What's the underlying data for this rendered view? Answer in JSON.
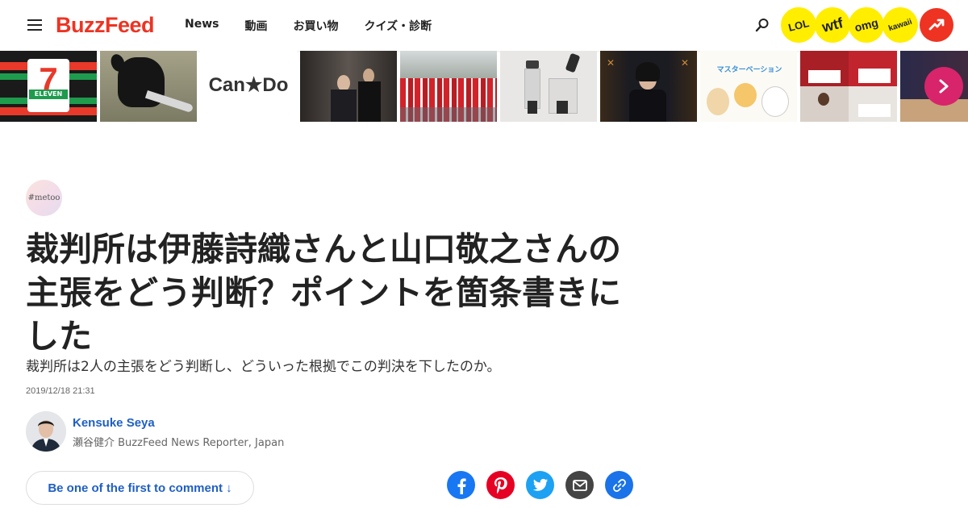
{
  "header": {
    "logo": "BuzzFeed",
    "nav": [
      {
        "label": "News"
      },
      {
        "label": "動画"
      },
      {
        "label": "お買い物"
      },
      {
        "label": "クイズ・診断"
      }
    ],
    "badges": [
      {
        "label": "LOL",
        "color": "#ffee00"
      },
      {
        "label": "wtf",
        "color": "#ffee00"
      },
      {
        "label": "omg",
        "color": "#ffee00"
      },
      {
        "label": "kawaii",
        "color": "#ffee00"
      }
    ],
    "trending_icon": "trending-arrow-icon",
    "accent_color": "#ee3322"
  },
  "thumbnails": {
    "items": [
      {
        "name": "seven-eleven-sign",
        "text": "ELEVEN",
        "numeral": "7"
      },
      {
        "name": "dog-with-knife"
      },
      {
        "name": "can-do-logo",
        "text": "Can★Do"
      },
      {
        "name": "press-crowd"
      },
      {
        "name": "santa-run-crowd"
      },
      {
        "name": "blender-product"
      },
      {
        "name": "press-conference-woman"
      },
      {
        "name": "manga-illustration",
        "text": "マスターベーション"
      },
      {
        "name": "people-with-signs"
      },
      {
        "name": "conference-panel"
      }
    ],
    "next_icon": "chevron-right-icon"
  },
  "article": {
    "tag": "#metoo",
    "title": "裁判所は伊藤詩織さんと山口敬之さんの主張をどう判断？ポイントを箇条書きにした",
    "subtitle": "裁判所は2人の主張をどう判断し、どういった根拠でこの判決を下したのか。",
    "timestamp": "2019/12/18 21:31",
    "author": {
      "name": "Kensuke Seya",
      "role": "瀬谷健介 BuzzFeed News Reporter, Japan"
    },
    "comment_label": "Be one of the first to comment ↓",
    "share": [
      {
        "name": "facebook",
        "color": "#1877f2"
      },
      {
        "name": "pinterest",
        "color": "#e60023"
      },
      {
        "name": "twitter",
        "color": "#1da1f2"
      },
      {
        "name": "email",
        "color": "#444444"
      },
      {
        "name": "copy-link",
        "color": "#1a73e8"
      }
    ]
  }
}
